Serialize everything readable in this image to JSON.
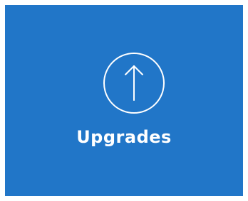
{
  "tile": {
    "label": "Upgrades",
    "icon": "arrow-up-circle-icon",
    "background_color": "#2176c8",
    "foreground_color": "#ffffff"
  }
}
